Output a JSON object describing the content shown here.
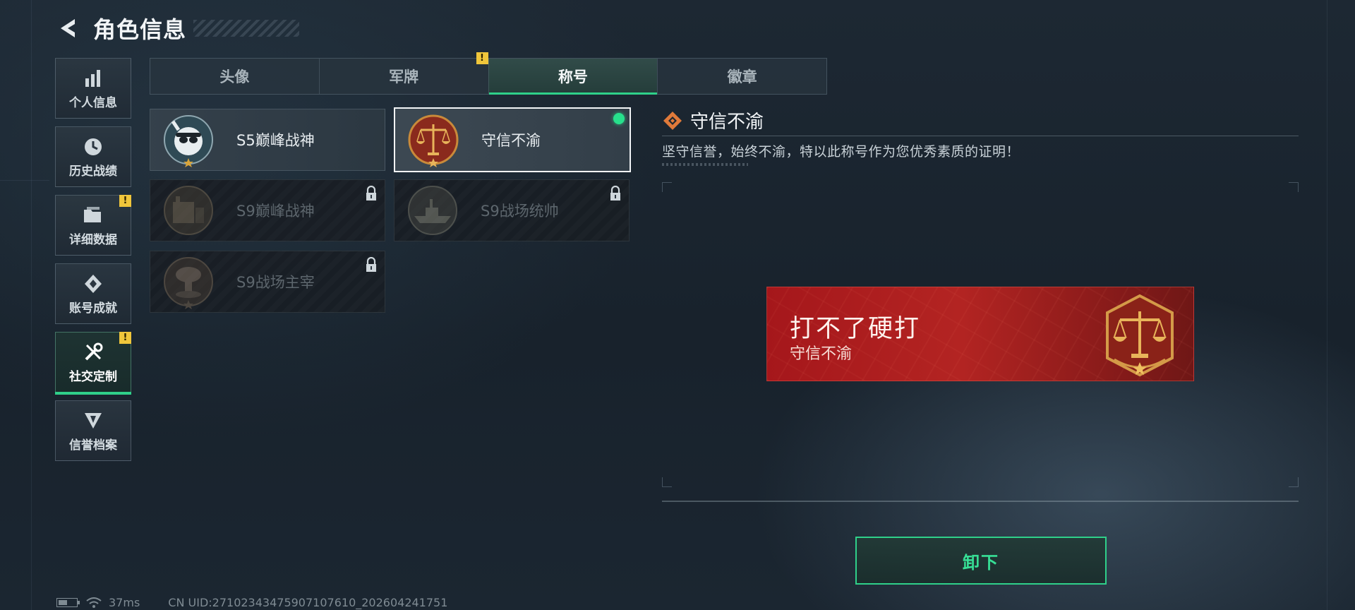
{
  "header": {
    "title": "角色信息"
  },
  "sidebar": {
    "items": [
      {
        "label": "个人信息",
        "icon": "bar-chart-icon",
        "badge": ""
      },
      {
        "label": "历史战绩",
        "icon": "clock-icon",
        "badge": ""
      },
      {
        "label": "详细数据",
        "icon": "folder-icon",
        "badge": "!"
      },
      {
        "label": "账号成就",
        "icon": "achievement-icon",
        "badge": ""
      },
      {
        "label": "社交定制",
        "icon": "tools-icon",
        "badge": "!",
        "active": true
      },
      {
        "label": "信誉档案",
        "icon": "reputation-icon",
        "badge": ""
      }
    ]
  },
  "tabs": [
    {
      "label": "头像"
    },
    {
      "label": "军牌",
      "badge": "!"
    },
    {
      "label": "称号",
      "active": true
    },
    {
      "label": "徽章"
    }
  ],
  "titles": [
    {
      "label": "S5巅峰战神",
      "locked": false,
      "emblem": "diver-skull-icon"
    },
    {
      "label": "守信不渝",
      "locked": false,
      "selected": true,
      "equipped": true,
      "emblem": "scales-icon"
    },
    {
      "label": "S9巅峰战神",
      "locked": true,
      "emblem": "tank-icon"
    },
    {
      "label": "S9战场统帅",
      "locked": true,
      "emblem": "warship-icon"
    },
    {
      "label": "S9战场主宰",
      "locked": true,
      "emblem": "explosion-icon"
    }
  ],
  "detail": {
    "name": "守信不渝",
    "description": "坚守信誉，始终不渝，特以此称号作为您优秀素质的证明！"
  },
  "banner": {
    "main": "打不了硬打",
    "sub": "守信不渝"
  },
  "action": {
    "unequip_label": "卸下"
  },
  "status": {
    "ping": "37ms",
    "uid": "CN UID:27102343475907107610_202604241751"
  },
  "colors": {
    "accent": "#2fd08a",
    "warning": "#f0c63b",
    "banner_red": "#a5171b"
  }
}
